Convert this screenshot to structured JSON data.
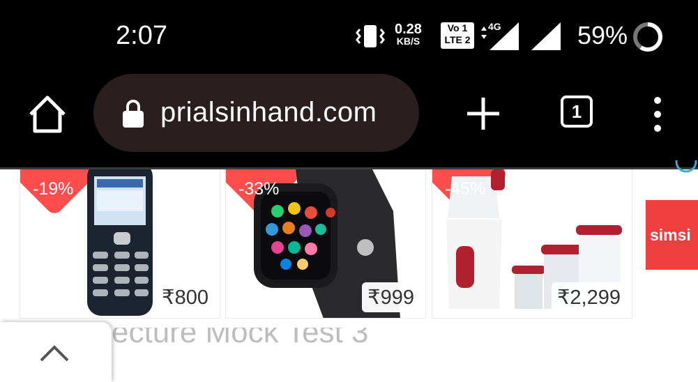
{
  "status_bar": {
    "time": "2:07",
    "net_speed_value": "0.28",
    "net_speed_unit": "KB/S",
    "network_type": "4G",
    "volte_label_top": "Vo",
    "volte_label_bottom": "LTE",
    "sim1": "1",
    "sim2": "2",
    "battery_percent": "59%",
    "icons": [
      "vibrate-icon",
      "volte-icon",
      "signal-icon",
      "battery-icon"
    ]
  },
  "browser": {
    "url": "prialsinhand.com",
    "tab_count": "1",
    "icons": [
      "home-icon",
      "lock-icon",
      "plus-icon",
      "tabs-icon",
      "more-vert-icon"
    ]
  },
  "products": [
    {
      "discount": "-19%",
      "price": "₹800"
    },
    {
      "discount": "-33%",
      "price": "₹999"
    },
    {
      "discount": "-45%",
      "price": "₹2,299"
    }
  ],
  "side_ad": {
    "text": "simsi"
  },
  "page_heading": "ecture Mock Test 3",
  "colors": {
    "chrome": "#000000",
    "url_bar": "#2b1e1e",
    "badge": "#ff4d4d",
    "ad": "#ee3e3e"
  }
}
